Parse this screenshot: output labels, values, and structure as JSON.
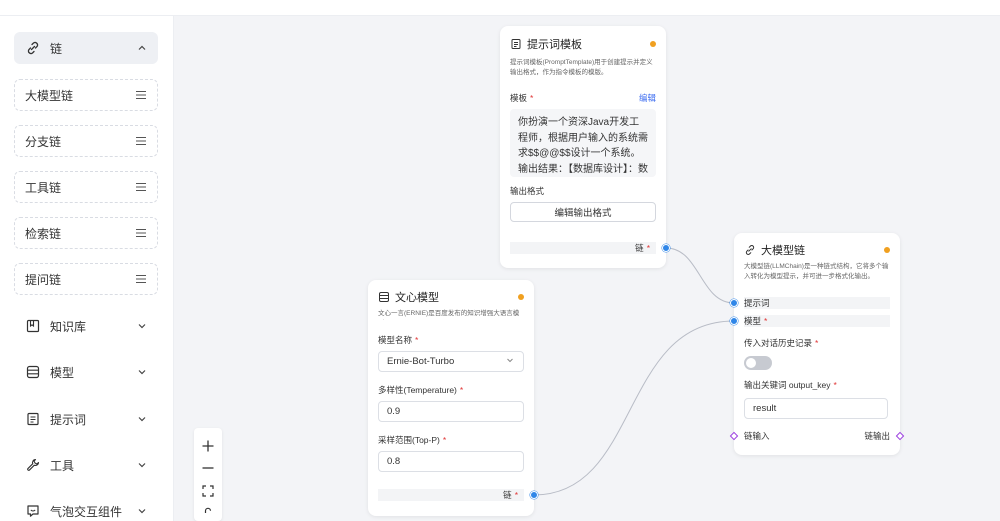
{
  "sidebar": {
    "groups": [
      {
        "label": "链",
        "icon": "link-icon",
        "expanded": true
      },
      {
        "label": "知识库",
        "icon": "book-icon"
      },
      {
        "label": "模型",
        "icon": "layers-icon"
      },
      {
        "label": "提示词",
        "icon": "document-icon"
      },
      {
        "label": "工具",
        "icon": "wrench-icon"
      },
      {
        "label": "气泡交互组件",
        "icon": "chat-bubble-icon"
      }
    ],
    "chain_items": [
      "大模型链",
      "分支链",
      "工具链",
      "检索链",
      "提问链"
    ]
  },
  "nodes": {
    "prompt": {
      "title": "提示词模板",
      "desc": "提示词模板(PromptTemplate)用于创建提示并定义输出格式，作为指令模板的模版。",
      "template_label": "模板",
      "edit_label": "编辑",
      "template_text": "你扮演一个资深Java开发工程师，根据用户输入的系统需求$$@@$$设计一个系统。 输出结果：【数据库设计】：数",
      "output_format_label": "输出格式",
      "edit_output_button": "编辑输出格式",
      "out_port_label": "链"
    },
    "wenxin": {
      "title": "文心模型",
      "desc": "文心一言(ERNIE)是百度发布的知识增强大语言模型。",
      "model_name_label": "模型名称",
      "model_name_value": "Ernie-Bot-Turbo",
      "temperature_label": "多样性(Temperature)",
      "temperature_value": "0.9",
      "top_p_label": "采样范围(Top-P)",
      "top_p_value": "0.8",
      "out_port_label": "链"
    },
    "llmchain": {
      "title": "大模型链",
      "desc": "大模型链(LLMChain)是一种链式结构，它将多个输入转化为模型提示，并可进一步格式化输出。",
      "prompt_port_label": "提示词",
      "model_port_label": "模型",
      "history_label": "传入对话历史记录",
      "output_key_label": "输出关键词 output_key",
      "output_key_value": "result",
      "chain_in_label": "链输入",
      "chain_out_label": "链输出"
    }
  },
  "colors": {
    "port": "#2f86e8",
    "status_dot": "#f0a020",
    "required": "#e03434",
    "link": "#3d6df0",
    "chain_port": "#9b3de0"
  }
}
